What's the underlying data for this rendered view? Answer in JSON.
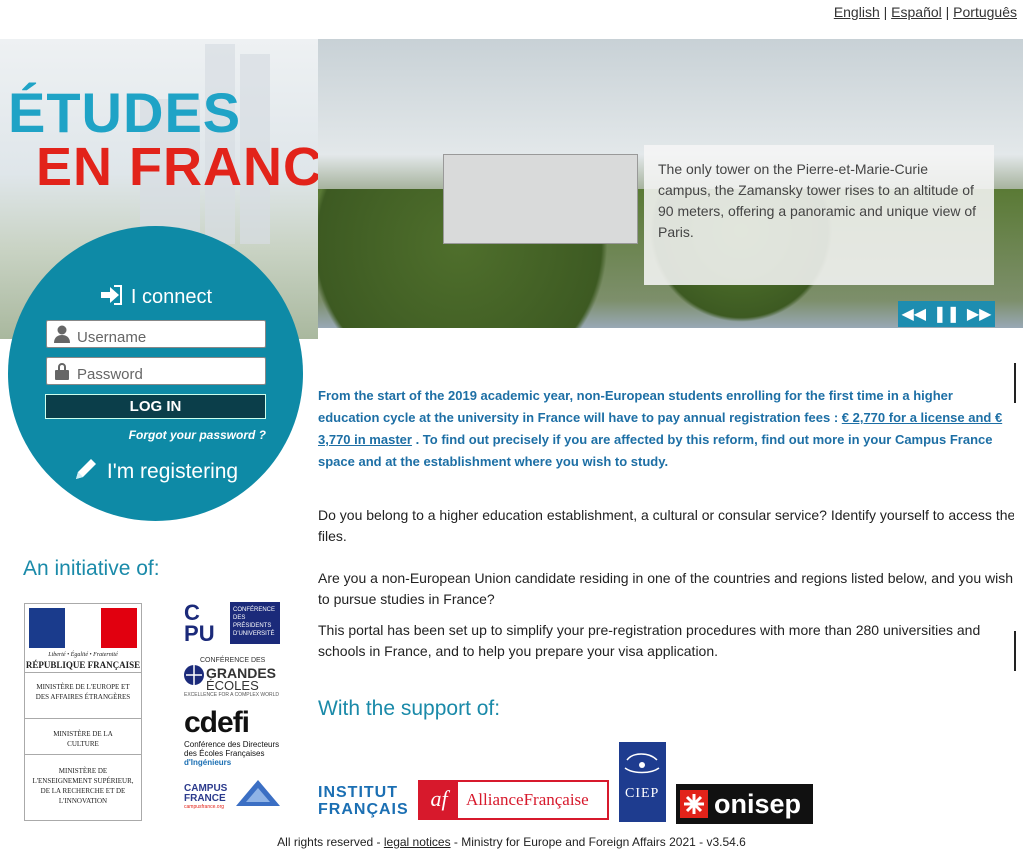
{
  "languages": [
    "English",
    "Español",
    "Português"
  ],
  "logo": {
    "line1": "ÉTUDES",
    "line2a": "EN ",
    "line2b": "FRANCE"
  },
  "login": {
    "connect_label": "I connect",
    "username_placeholder": "Username",
    "password_placeholder": "Password",
    "login_button": "LOG IN",
    "forgot_link": "Forgot your password ?",
    "register_label": "I'm registering"
  },
  "banner": {
    "caption": "The only tower on the Pierre-et-Marie-Curie campus, the Zamansky tower rises to an altitude of 90 meters, offering a panoramic and unique view of Paris."
  },
  "notice": {
    "text1": "From the start of the 2019 academic year, non-European students enrolling for the first time in a higher education cycle at the university in France will have to pay annual registration fees : ",
    "link": "€ 2,770 for a license and € 3,770 in master",
    "text2": " . To find out precisely if you are affected by this reform, find out more in your Campus France space and at the establishment where you wish to study."
  },
  "paragraphs": [
    "Do you belong to a higher education establishment, a cultural or consular service? Identify yourself to access the files.",
    "Are you a non-European Union candidate residing in one of the countries and regions listed below, and you wish to pursue studies in France?",
    "This portal has been set up to simplify your pre-registration procedures with more than 280 universities and schools in France, and to help you prepare your visa application."
  ],
  "initiative_title": "An initiative of:",
  "support_title": "With the support of:",
  "republique": {
    "motto": "Liberté • Égalité • Fraternité",
    "name": "RÉPUBLIQUE FRANÇAISE",
    "m1": "MINISTÈRE DE L'EUROPE ET DES AFFAIRES ÉTRANGÈRES",
    "m2": "MINISTÈRE DE LA CULTURE",
    "m3": "MINISTÈRE DE L'ENSEIGNEMENT SUPÉRIEUR, DE LA RECHERCHE ET DE L'INNOVATION"
  },
  "cpu": {
    "a": "C",
    "b": "P",
    "c": "U",
    "text": "CONFÉRENCE DES PRÉSIDENTS D'UNIVERSITÉ"
  },
  "cge": {
    "top": "CONFÉRENCE DES",
    "mid": "GRANDES",
    "bot": "ÉCOLES",
    "tag": "EXCELLENCE FOR A COMPLEX WORLD"
  },
  "cdefi": {
    "logo": "cdefi",
    "text1": "Conférence des Directeurs",
    "text2": "des Écoles Françaises",
    "text3": "d'Ingénieurs"
  },
  "campus": {
    "l1": "CAMPUS",
    "l2": "FRANCE",
    "url": "campusfrance.org"
  },
  "institut": {
    "l1": "INSTITUT",
    "l2": "FRANÇAIS"
  },
  "alliance": {
    "af": "af",
    "name": "AllianceFrançaise"
  },
  "ciep": "CIEP",
  "onisep": "onisep",
  "footer": {
    "rights": "All rights reserved - ",
    "legal": "legal notices",
    "rest": " - Ministry for Europe and Foreign Affairs 2021 - v3.54.6"
  },
  "colors": {
    "accent": "#0e8aa6",
    "red": "#e2231a",
    "blue": "#1fa3c6",
    "notice": "#1d6fa5"
  }
}
